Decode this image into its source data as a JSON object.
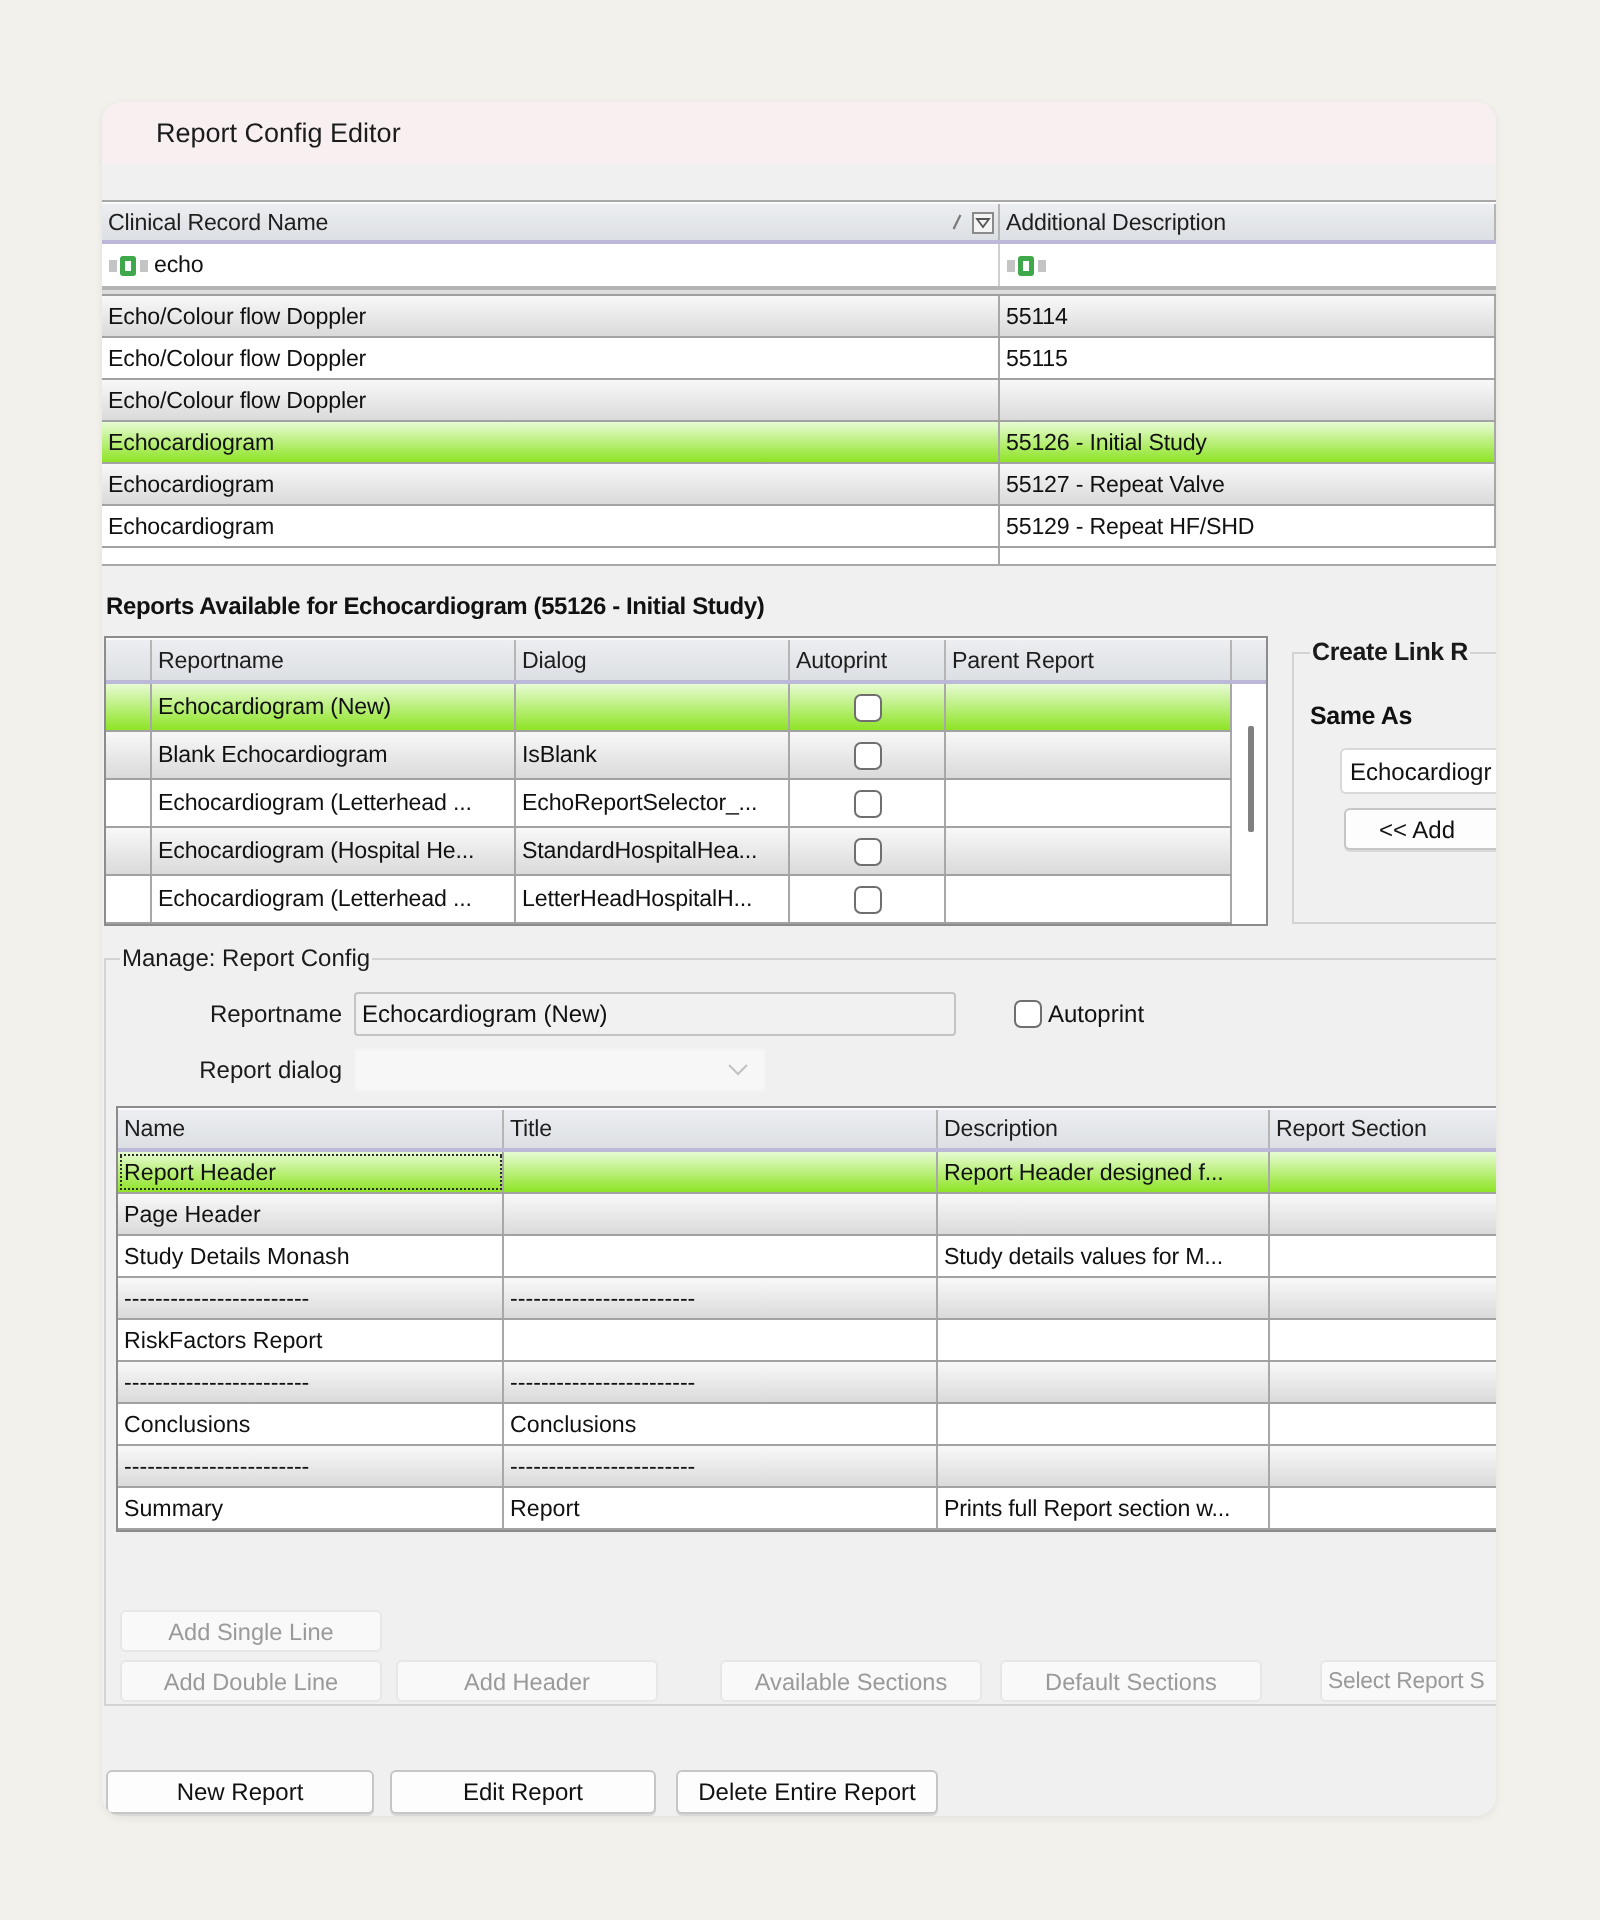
{
  "window": {
    "title": "Report Config Editor"
  },
  "records": {
    "columns": [
      {
        "label": "Clinical Record Name",
        "sorted": true,
        "filter_menu": true,
        "filter": "echo"
      },
      {
        "label": "Additional Description",
        "sorted": false,
        "filter_menu": false
      }
    ],
    "rows": [
      {
        "name": "Echo/Colour flow Doppler",
        "description": "55114",
        "selected": false
      },
      {
        "name": "Echo/Colour flow Doppler",
        "description": "55115",
        "selected": false
      },
      {
        "name": "Echo/Colour flow Doppler",
        "selected": false
      },
      {
        "name": "Echocardiogram",
        "description": "55126 - Initial Study",
        "selected": true
      },
      {
        "name": "Echocardiogram",
        "description": "55127 - Repeat Valve",
        "selected": false
      },
      {
        "name": "Echocardiogram",
        "description": "55129 - Repeat HF/SHD",
        "selected": false
      }
    ]
  },
  "reports": {
    "title": "Reports Available for Echocardiogram (55126 - Initial Study)",
    "columns": [
      "Reportname",
      "Dialog",
      "Autoprint",
      "Parent Report"
    ],
    "rows": [
      {
        "reportname": "Echocardiogram (New)",
        "autoprint": false,
        "selected": true
      },
      {
        "reportname": "Blank Echocardiogram",
        "dialog": "IsBlank",
        "autoprint": false,
        "selected": false
      },
      {
        "reportname": "Echocardiogram (Letterhead ...",
        "dialog": "EchoReportSelector_...",
        "autoprint": false,
        "selected": false
      },
      {
        "reportname": "Echocardiogram (Hospital He...",
        "dialog": "StandardHospitalHea...",
        "autoprint": false,
        "selected": false
      },
      {
        "reportname": "Echocardiogram (Letterhead ...",
        "dialog": "LetterHeadHospitalH...",
        "autoprint": false,
        "selected": false
      }
    ]
  },
  "link_report": {
    "title": "Create Link R",
    "same_as_label": "Same As",
    "same_as_value": "Echocardiogr",
    "add_button": "<< Add"
  },
  "manage": {
    "title": "Manage: Report Config",
    "reportname_label": "Reportname",
    "reportname": "Echocardiogram (New)",
    "autoprint_label": "Autoprint",
    "autoprint": false,
    "dialog_label": "Report dialog",
    "dialog_disabled": true,
    "sections": {
      "columns": [
        "Name",
        "Title",
        "Description",
        "Report Section"
      ],
      "rows": [
        {
          "name": "Report Header",
          "description": "Report Header designed f...",
          "selected": true,
          "focused": true
        },
        {
          "name": "Page Header",
          "selected": false,
          "focused": false
        },
        {
          "name": "Study Details Monash",
          "description": "Study details values for M...",
          "selected": false,
          "focused": false
        },
        {
          "name": "------------------------",
          "title": "------------------------",
          "selected": false,
          "focused": false
        },
        {
          "name": "RiskFactors Report",
          "selected": false,
          "focused": false
        },
        {
          "name": "------------------------",
          "title": "------------------------",
          "selected": false,
          "focused": false
        },
        {
          "name": "Conclusions",
          "title": "Conclusions",
          "selected": false,
          "focused": false
        },
        {
          "name": "------------------------",
          "title": "------------------------",
          "selected": false,
          "focused": false
        },
        {
          "name": "Summary",
          "title": "Report",
          "description": "Prints full Report section w...",
          "selected": false,
          "focused": false
        }
      ]
    },
    "button_rows": [
      [
        {
          "label": "Add Single Line",
          "disabled": true
        }
      ],
      [
        {
          "label": "Add Double Line",
          "disabled": true
        },
        {
          "label": "Add Header",
          "disabled": true
        },
        {
          "label": "Available Sections",
          "disabled": true
        },
        {
          "label": "Default Sections",
          "disabled": true
        },
        {
          "label": "Select Report S",
          "disabled": true
        }
      ]
    ]
  },
  "footer_buttons": [
    "New Report",
    "Edit Report",
    "Delete Entire Report"
  ]
}
